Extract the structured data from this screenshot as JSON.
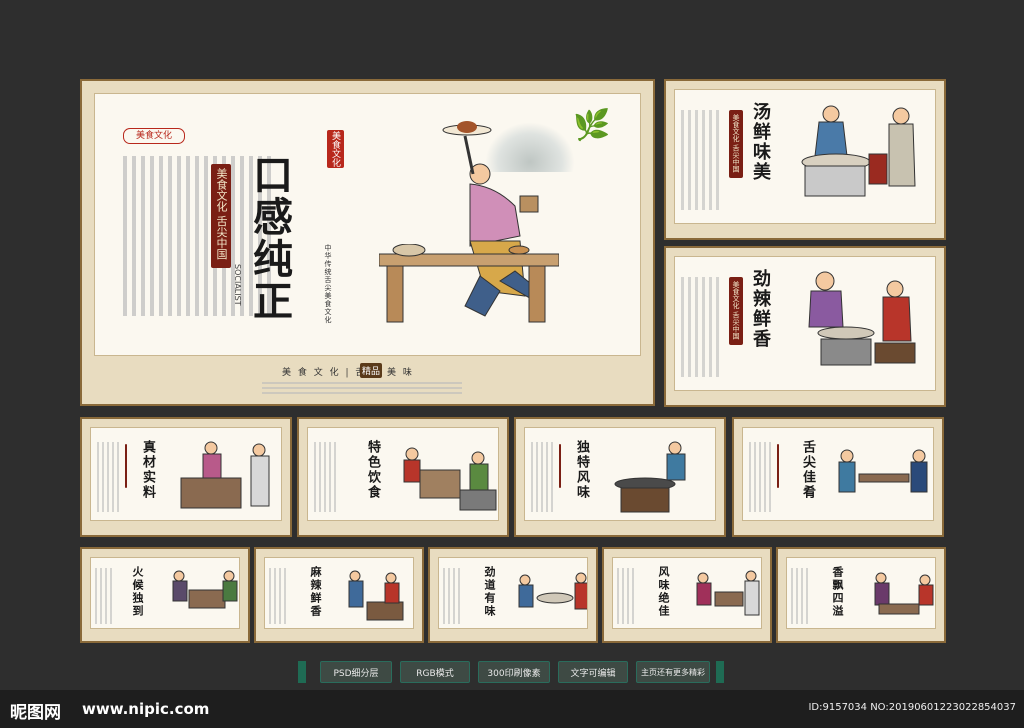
{
  "main_poster": {
    "badge": "美食文化",
    "stripe": "美食文化 舌尖中国",
    "title": "口感纯正",
    "subtitle_vertical": "中华传统舌尖美食文化",
    "latin": "SOCIALIST",
    "seal_text": "美食文化",
    "bottom_caption": "美 食 文 化 | 舌 尖 美 味",
    "bottom_seal": "精品"
  },
  "side_posters": [
    {
      "title": "汤鲜味美",
      "stripe": "美食文化 舌尖中国"
    },
    {
      "title": "劲辣鲜香",
      "stripe": "美食文化 舌尖中国"
    }
  ],
  "row2_posters": [
    {
      "title": "真材实料"
    },
    {
      "title": "特色饮食"
    },
    {
      "title": "独特风味"
    },
    {
      "title": "舌尖佳肴"
    }
  ],
  "row3_posters": [
    {
      "title": "火候独到"
    },
    {
      "title": "麻辣鲜香"
    },
    {
      "title": "劲道有味"
    },
    {
      "title": "风味绝佳"
    },
    {
      "title": "香飘四溢"
    }
  ],
  "buttons": [
    "PSD细分层",
    "RGB模式",
    "300印刷像素",
    "文字可编辑",
    "主页还有更多精彩"
  ],
  "footer": {
    "logo": "昵图网",
    "url": "www.nipic.com",
    "id_text": "ID:9157034 NO:20190601223022854037"
  },
  "colors": {
    "background": "#2e2e2e",
    "frame": "#e8dcc0",
    "accent_red": "#7a1f14",
    "button": "#3e4a44"
  }
}
